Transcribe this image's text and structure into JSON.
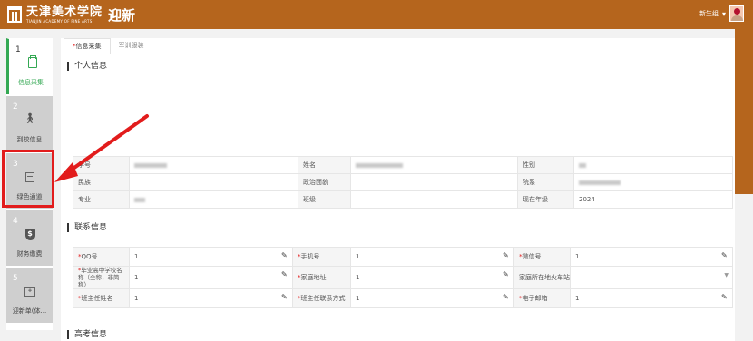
{
  "header": {
    "school_cn": "天津美术学院",
    "school_en": "TIANJIN ACADEMY OF FINE ARTS",
    "page_title": "迎新",
    "user_label": "新生组",
    "brand_color": "#b5651d"
  },
  "sidebar": {
    "steps": [
      {
        "num": "1",
        "label": "信息采集",
        "icon": "clipboard-icon"
      },
      {
        "num": "2",
        "label": "到校信息",
        "icon": "walking-icon"
      },
      {
        "num": "3",
        "label": "绿色通道",
        "icon": "calendar-icon"
      },
      {
        "num": "4",
        "label": "财务缴费",
        "icon": "shield-dollar-icon",
        "glyph": "$"
      },
      {
        "num": "5",
        "label": "迎新单(体...",
        "icon": "bag-icon"
      }
    ]
  },
  "tabs": [
    {
      "label": "信息采集",
      "required": "*"
    },
    {
      "label": "军训服装"
    }
  ],
  "personal": {
    "title": "个人信息",
    "rows": [
      [
        {
          "k": "学号"
        },
        {
          "v": ""
        },
        {
          "k": "姓名"
        },
        {
          "v": ""
        },
        {
          "k": "性别"
        },
        {
          "v": ""
        }
      ],
      [
        {
          "k": "民族"
        },
        {
          "v": ""
        },
        {
          "k": "政治面貌"
        },
        {
          "v": ""
        },
        {
          "k": "院系"
        },
        {
          "v": ""
        }
      ],
      [
        {
          "k": "专业"
        },
        {
          "v": ""
        },
        {
          "k": "班级"
        },
        {
          "v": ""
        },
        {
          "k": "现在年级"
        },
        {
          "v": "2024"
        }
      ]
    ]
  },
  "contact": {
    "title": "联系信息",
    "required_mark": "*",
    "fields": [
      [
        {
          "label": "QQ号",
          "value": "1",
          "required": true
        },
        {
          "label": "手机号",
          "value": "1",
          "required": true
        },
        {
          "label": "微信号",
          "value": "1",
          "required": true
        }
      ],
      [
        {
          "label": "毕业高中学校名称（全称，非简称）",
          "value": "1",
          "required": true
        },
        {
          "label": "家庭地址",
          "value": "1",
          "required": true
        },
        {
          "label": "家庭所在地火车站",
          "value": "",
          "required": false,
          "select": true
        }
      ],
      [
        {
          "label": "班主任姓名",
          "value": "1",
          "required": true
        },
        {
          "label": "班主任联系方式",
          "value": "1",
          "required": true
        },
        {
          "label": "电子邮箱",
          "value": "1",
          "required": true
        }
      ]
    ]
  },
  "exam": {
    "title": "高考信息"
  }
}
